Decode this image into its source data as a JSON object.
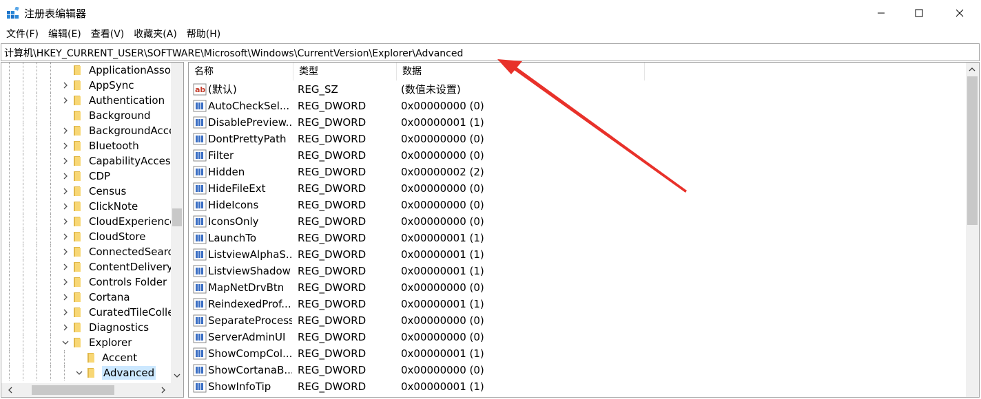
{
  "window": {
    "title": "注册表编辑器",
    "minimize_icon": "minimize-icon",
    "maximize_icon": "maximize-icon",
    "close_icon": "close-icon"
  },
  "menu": [
    "文件(F)",
    "编辑(E)",
    "查看(V)",
    "收藏夹(A)",
    "帮助(H)"
  ],
  "address": "计算机\\HKEY_CURRENT_USER\\SOFTWARE\\Microsoft\\Windows\\CurrentVersion\\Explorer\\Advanced",
  "tree": [
    {
      "label": "ApplicationAsso",
      "level": 4,
      "expander": "none"
    },
    {
      "label": "AppSync",
      "level": 4,
      "expander": "collapsed"
    },
    {
      "label": "Authentication",
      "level": 4,
      "expander": "collapsed"
    },
    {
      "label": "Background",
      "level": 4,
      "expander": "none"
    },
    {
      "label": "BackgroundAcce",
      "level": 4,
      "expander": "collapsed"
    },
    {
      "label": "Bluetooth",
      "level": 4,
      "expander": "collapsed"
    },
    {
      "label": "CapabilityAccess",
      "level": 4,
      "expander": "collapsed"
    },
    {
      "label": "CDP",
      "level": 4,
      "expander": "collapsed"
    },
    {
      "label": "Census",
      "level": 4,
      "expander": "collapsed"
    },
    {
      "label": "ClickNote",
      "level": 4,
      "expander": "collapsed"
    },
    {
      "label": "CloudExperience",
      "level": 4,
      "expander": "collapsed"
    },
    {
      "label": "CloudStore",
      "level": 4,
      "expander": "collapsed"
    },
    {
      "label": "ConnectedSearc",
      "level": 4,
      "expander": "collapsed"
    },
    {
      "label": "ContentDelivery",
      "level": 4,
      "expander": "collapsed"
    },
    {
      "label": "Controls Folder",
      "level": 4,
      "expander": "collapsed"
    },
    {
      "label": "Cortana",
      "level": 4,
      "expander": "collapsed"
    },
    {
      "label": "CuratedTileColle",
      "level": 4,
      "expander": "collapsed"
    },
    {
      "label": "Diagnostics",
      "level": 4,
      "expander": "collapsed"
    },
    {
      "label": "Explorer",
      "level": 4,
      "expander": "expanded"
    },
    {
      "label": "Accent",
      "level": 5,
      "expander": "none"
    },
    {
      "label": "Advanced",
      "level": 5,
      "expander": "expanded",
      "selected": true
    }
  ],
  "columns": {
    "name": "名称",
    "type": "类型",
    "data": "数据"
  },
  "values": [
    {
      "name": "(默认)",
      "type": "REG_SZ",
      "data": "(数值未设置)",
      "icon": "string-value-icon"
    },
    {
      "name": "AutoCheckSel...",
      "type": "REG_DWORD",
      "data": "0x00000000 (0)",
      "icon": "dword-value-icon"
    },
    {
      "name": "DisablePreview...",
      "type": "REG_DWORD",
      "data": "0x00000001 (1)",
      "icon": "dword-value-icon"
    },
    {
      "name": "DontPrettyPath",
      "type": "REG_DWORD",
      "data": "0x00000000 (0)",
      "icon": "dword-value-icon"
    },
    {
      "name": "Filter",
      "type": "REG_DWORD",
      "data": "0x00000000 (0)",
      "icon": "dword-value-icon"
    },
    {
      "name": "Hidden",
      "type": "REG_DWORD",
      "data": "0x00000002 (2)",
      "icon": "dword-value-icon"
    },
    {
      "name": "HideFileExt",
      "type": "REG_DWORD",
      "data": "0x00000000 (0)",
      "icon": "dword-value-icon"
    },
    {
      "name": "HideIcons",
      "type": "REG_DWORD",
      "data": "0x00000000 (0)",
      "icon": "dword-value-icon"
    },
    {
      "name": "IconsOnly",
      "type": "REG_DWORD",
      "data": "0x00000000 (0)",
      "icon": "dword-value-icon"
    },
    {
      "name": "LaunchTo",
      "type": "REG_DWORD",
      "data": "0x00000001 (1)",
      "icon": "dword-value-icon"
    },
    {
      "name": "ListviewAlphaS...",
      "type": "REG_DWORD",
      "data": "0x00000001 (1)",
      "icon": "dword-value-icon"
    },
    {
      "name": "ListviewShadow",
      "type": "REG_DWORD",
      "data": "0x00000001 (1)",
      "icon": "dword-value-icon"
    },
    {
      "name": "MapNetDrvBtn",
      "type": "REG_DWORD",
      "data": "0x00000000 (0)",
      "icon": "dword-value-icon"
    },
    {
      "name": "ReindexedProf...",
      "type": "REG_DWORD",
      "data": "0x00000001 (1)",
      "icon": "dword-value-icon"
    },
    {
      "name": "SeparateProcess",
      "type": "REG_DWORD",
      "data": "0x00000000 (0)",
      "icon": "dword-value-icon"
    },
    {
      "name": "ServerAdminUI",
      "type": "REG_DWORD",
      "data": "0x00000000 (0)",
      "icon": "dword-value-icon"
    },
    {
      "name": "ShowCompCol...",
      "type": "REG_DWORD",
      "data": "0x00000001 (1)",
      "icon": "dword-value-icon"
    },
    {
      "name": "ShowCortanaB...",
      "type": "REG_DWORD",
      "data": "0x00000000 (0)",
      "icon": "dword-value-icon"
    },
    {
      "name": "ShowInfoTip",
      "type": "REG_DWORD",
      "data": "0x00000001 (1)",
      "icon": "dword-value-icon"
    }
  ],
  "colors": {
    "selection": "#cce8ff",
    "folder": "#f8d775",
    "folder_dark": "#e0b84a",
    "annotation_arrow": "#e8312a",
    "dword_icon": "#3b6fc4",
    "string_icon": "#c43b2a"
  }
}
